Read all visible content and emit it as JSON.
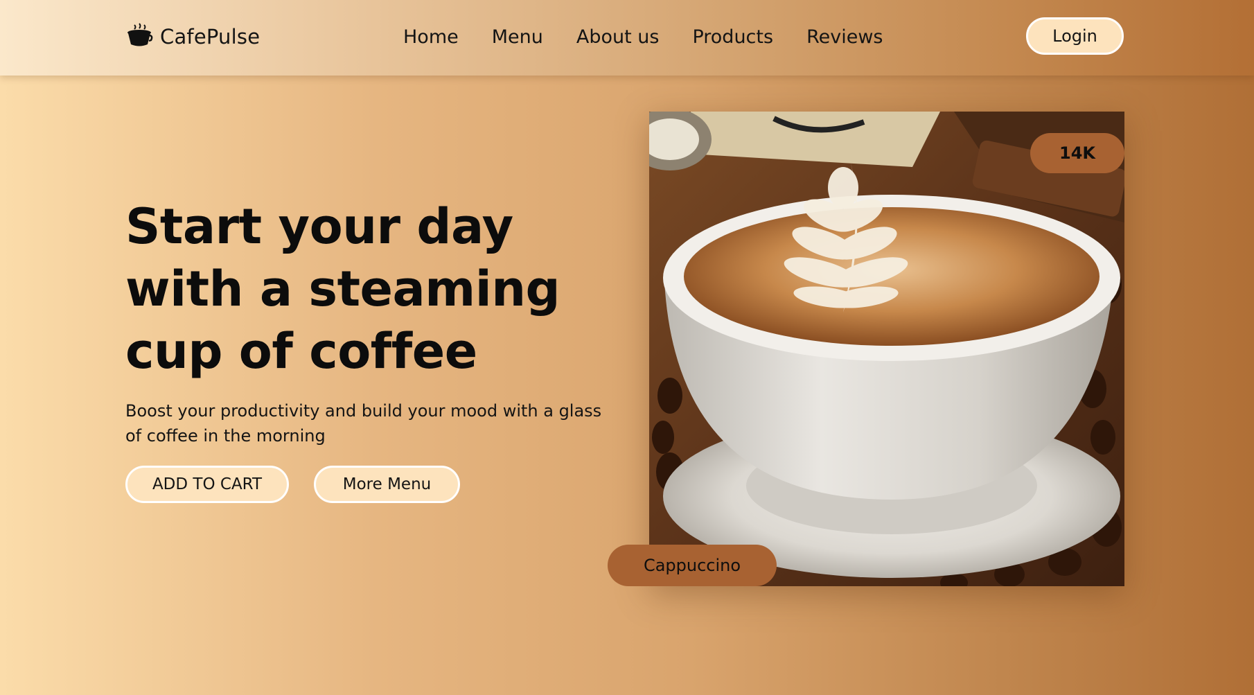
{
  "brand": {
    "name": "CafePulse",
    "icon": "coffee-cup-icon"
  },
  "nav": {
    "links": [
      "Home",
      "Menu",
      "About us",
      "Products",
      "Reviews"
    ],
    "login_label": "Login"
  },
  "hero": {
    "title": "Start your day with a steaming cup of coffee",
    "subtitle": "Boost your productivity and build your mood with a glass of coffee in the morning",
    "add_to_cart_label": "ADD TO CART",
    "more_menu_label": "More Menu"
  },
  "product": {
    "count_badge": "14K",
    "name": "Cappuccino",
    "image": "cappuccino-latte-art-photo"
  },
  "colors": {
    "accent": "#a86232",
    "button_fill": "#fde3bd",
    "gradient_light": "#fbdcaa",
    "gradient_dark": "#b06f36"
  }
}
